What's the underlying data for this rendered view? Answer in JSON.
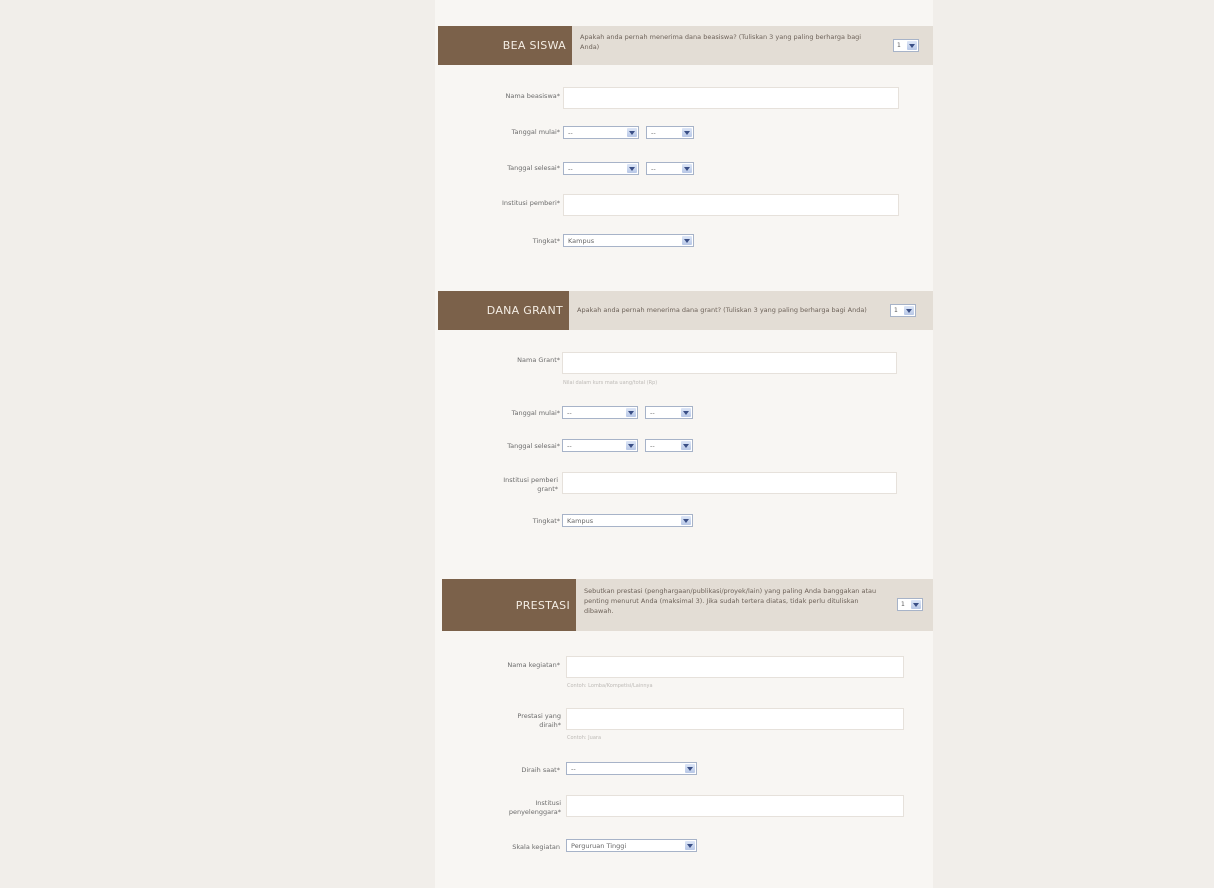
{
  "sections": {
    "beasiswa": {
      "title": "BEA SISWA",
      "question": "Apakah anda pernah menerima dana beasiswa? (Tuliskan 3 yang paling berharga bagi Anda)",
      "count": "1",
      "fields": {
        "nama": "Nama beasiswa*",
        "mulai": "Tanggal mulai*",
        "selesai": "Tanggal selesai*",
        "institusi": "Institusi pemberi*",
        "tingkat": "Tingkat*"
      },
      "date_placeholder": "--",
      "tingkat_value": "Kampus"
    },
    "grant": {
      "title": "DANA GRANT",
      "question": "Apakah anda pernah menerima dana grant? (Tuliskan 3 yang paling berharga bagi Anda)",
      "count": "1",
      "fields": {
        "nama": "Nama Grant*",
        "nama_hint": "Nilai dalam kurs mata uang/total (Rp)",
        "mulai": "Tanggal mulai*",
        "selesai": "Tanggal selesai*",
        "institusi": "Institusi pemberi grant*",
        "tingkat": "Tingkat*"
      },
      "date_placeholder": "--",
      "tingkat_value": "Kampus"
    },
    "prestasi": {
      "title": "PRESTASI",
      "question": "Sebutkan prestasi (penghargaan/publikasi/proyek/lain) yang paling Anda banggakan atau penting menurut Anda (maksimal 3). Jika sudah tertera diatas, tidak perlu dituliskan dibawah.",
      "count": "1",
      "fields": {
        "nama": "Nama kegiatan*",
        "nama_hint": "Contoh: Lomba/Kompetisi/Lainnya",
        "prestasi": "Prestasi yang diraih*",
        "prestasi_hint": "Contoh: Juara",
        "diraih": "Diraih saat*",
        "institusi": "Institusi penyelenggara*",
        "skala": "Skala kegiatan"
      },
      "date_placeholder": "--",
      "skala_value": "Perguruan Tinggi"
    }
  }
}
